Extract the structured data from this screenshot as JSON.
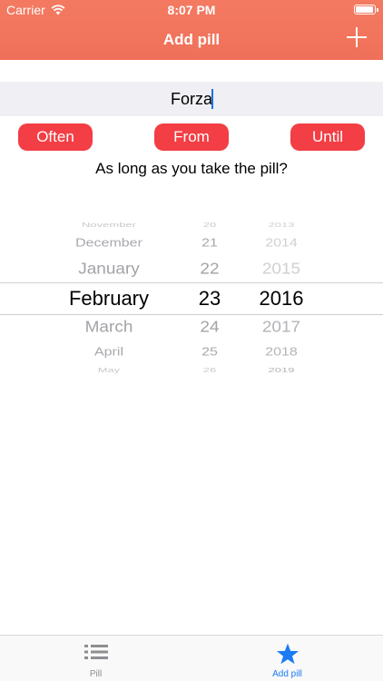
{
  "status_bar": {
    "carrier": "Carrier",
    "time": "8:07 PM"
  },
  "nav": {
    "title": "Add pill",
    "add_icon": "plus-icon"
  },
  "name_input": {
    "value": "Forza"
  },
  "buttons": {
    "often": "Often",
    "from": "From",
    "until": "Until"
  },
  "question": "As long as you take the pill?",
  "picker": {
    "months": [
      "November",
      "December",
      "January",
      "February",
      "March",
      "April",
      "May"
    ],
    "days": [
      "20",
      "21",
      "22",
      "23",
      "24",
      "25",
      "26"
    ],
    "years": [
      "2013",
      "2014",
      "2015",
      "2016",
      "2017",
      "2018",
      "2019"
    ],
    "selected": {
      "month": "February",
      "day": "23",
      "year": "2016"
    }
  },
  "tabbar": {
    "tabs": [
      {
        "label": "Pill",
        "icon": "list-icon"
      },
      {
        "label": "Add pill",
        "icon": "star-icon"
      }
    ],
    "selected_color": "#1b7bf5",
    "unselected_color": "#8e8e93"
  },
  "colors": {
    "nav_bar": "#f07059",
    "button": "#f23e44"
  }
}
